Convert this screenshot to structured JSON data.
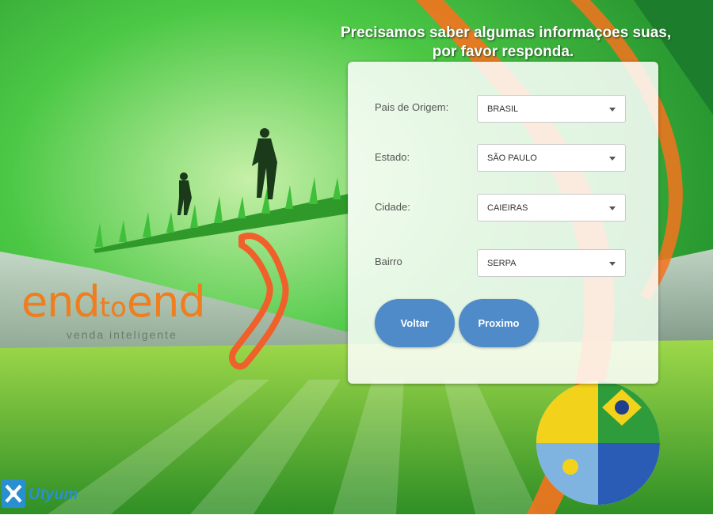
{
  "header": {
    "line1": "Precisamos saber algumas informaçoes suas,",
    "line2": "por favor responda."
  },
  "form": {
    "country": {
      "label": "Pais de Origem:",
      "value": "BRASIL"
    },
    "state": {
      "label": "Estado:",
      "value": "SÃO PAULO"
    },
    "city": {
      "label": "Cidade:",
      "value": "CAIEIRAS"
    },
    "district": {
      "label": "Bairro",
      "value": "SERPA"
    }
  },
  "buttons": {
    "back": "Voltar",
    "next": "Proximo"
  },
  "brand": {
    "name_start": "end",
    "name_mid": "to",
    "name_end": "end",
    "tagline": "venda inteligente"
  },
  "footer": {
    "logo_text": "Utyum"
  },
  "colors": {
    "accent": "#f07d1e",
    "button": "#4f8bc9",
    "grass": "#3fae3a"
  }
}
